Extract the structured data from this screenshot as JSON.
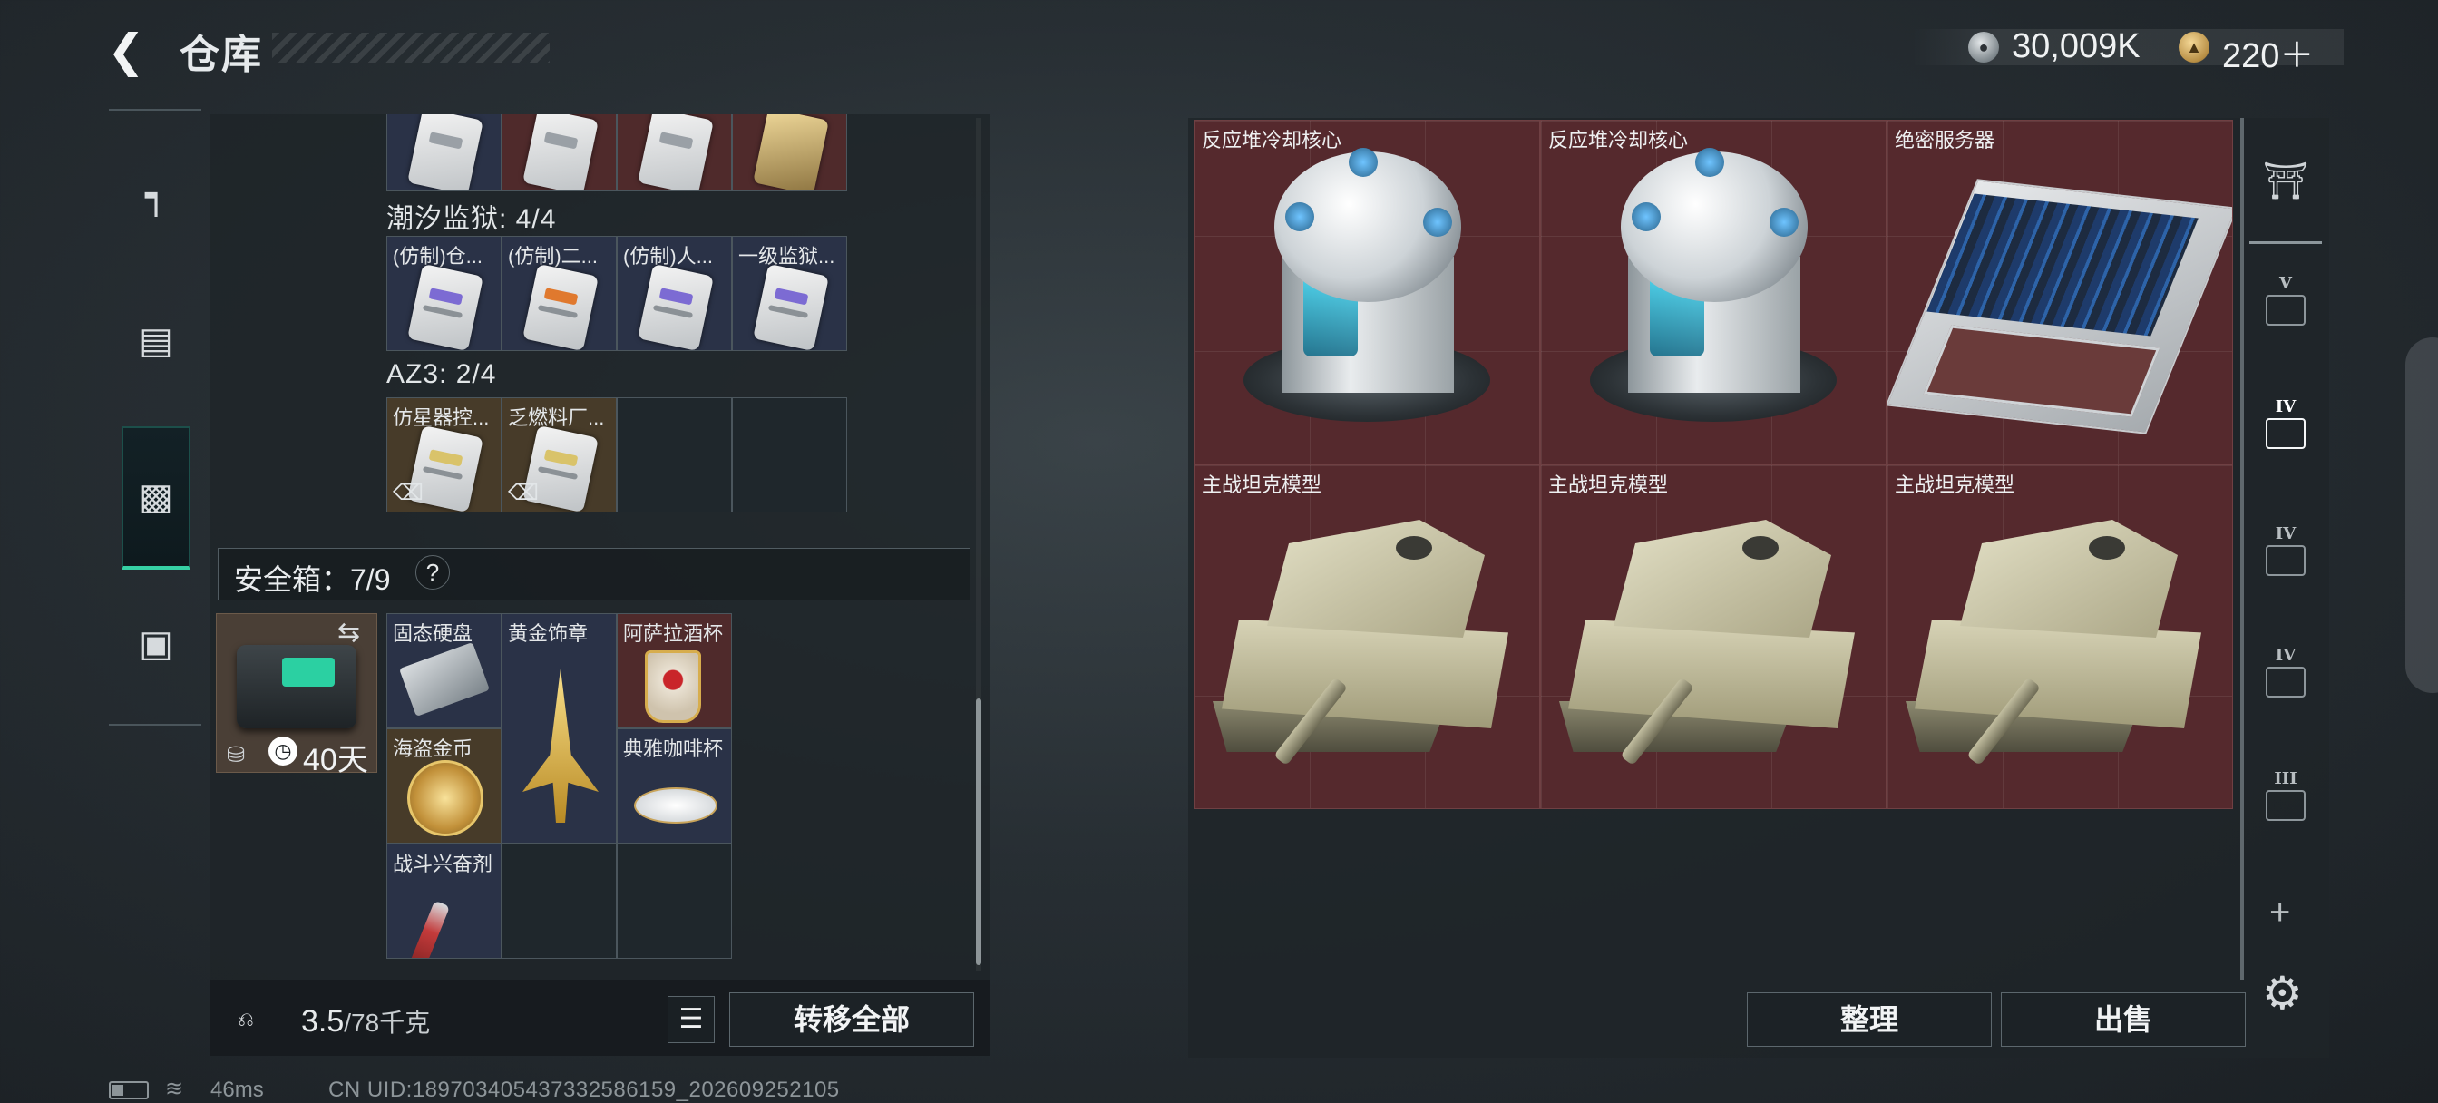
{
  "header": {
    "title": "仓库",
    "currency_silver": "30,009K",
    "currency_gold": "220＋"
  },
  "sidebar": {
    "items": [
      {
        "name": "weapon",
        "icon": "pistol-icon"
      },
      {
        "name": "armor",
        "icon": "armor-vest-icon"
      },
      {
        "name": "backpack",
        "icon": "backpack-icon",
        "active": true
      },
      {
        "name": "case",
        "icon": "briefcase-icon"
      }
    ]
  },
  "containers": [
    {
      "title": "潮汐监狱: 4/4",
      "items": [
        "(仿制)仓...",
        "(仿制)二...",
        "(仿制)人...",
        "一级监狱..."
      ]
    },
    {
      "title": "AZ3: 2/4",
      "items": [
        "仿星器控...",
        "乏燃料厂...",
        "",
        ""
      ]
    }
  ],
  "safe_box": {
    "label": "安全箱：7/9",
    "help": "?",
    "days": "40天",
    "items": [
      "固态硬盘",
      "黄金饰章",
      "阿萨拉酒杯",
      "海盗金币",
      "典雅咖啡杯",
      "战斗兴奋剂"
    ]
  },
  "weight": {
    "current": "3.5",
    "capacity": "/78千克"
  },
  "buttons": {
    "transfer_all": "转移全部",
    "sort": "整理",
    "sell": "出售"
  },
  "stash_items": [
    {
      "name": "反应堆冷却核心",
      "icon": "reactor-core-icon"
    },
    {
      "name": "反应堆冷却核心",
      "icon": "reactor-core-icon"
    },
    {
      "name": "绝密服务器",
      "icon": "server-icon"
    },
    {
      "name": "主战坦克模型",
      "icon": "tank-model-icon"
    },
    {
      "name": "主战坦克模型",
      "icon": "tank-model-icon"
    },
    {
      "name": "主战坦克模型",
      "icon": "tank-model-icon"
    }
  ],
  "right_sidebar": {
    "tiers": [
      "V",
      "IV",
      "IV",
      "IV",
      "III"
    ],
    "plus": "+"
  },
  "status": {
    "ping": "46ms",
    "uid": "CN UID:18970340543733258615‌9_202609252105"
  },
  "colors": {
    "accent": "#36d1a5",
    "valuable_bg": "#55292d",
    "gold_bg": "#473b29"
  }
}
